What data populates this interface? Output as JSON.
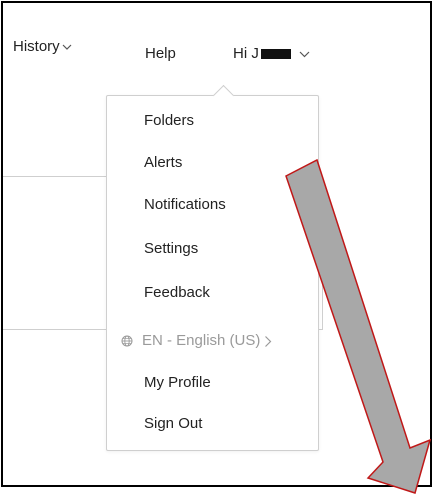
{
  "nav": {
    "history_label": "History",
    "help_label": "Help",
    "user_greeting": "Hi J"
  },
  "menu": {
    "items": [
      {
        "label": "Folders"
      },
      {
        "label": "Alerts"
      },
      {
        "label": "Notifications"
      },
      {
        "label": "Settings"
      },
      {
        "label": "Feedback"
      },
      {
        "label": "EN - English (US)"
      },
      {
        "label": "My Profile"
      },
      {
        "label": "Sign Out"
      }
    ]
  },
  "annotation": {
    "arrow_fill": "#a8a8a8",
    "arrow_stroke": "#c01818"
  },
  "icons": {
    "nav_chevron": "chevron-down-icon",
    "language": "globe-icon",
    "submenu": "chevron-right-icon"
  }
}
